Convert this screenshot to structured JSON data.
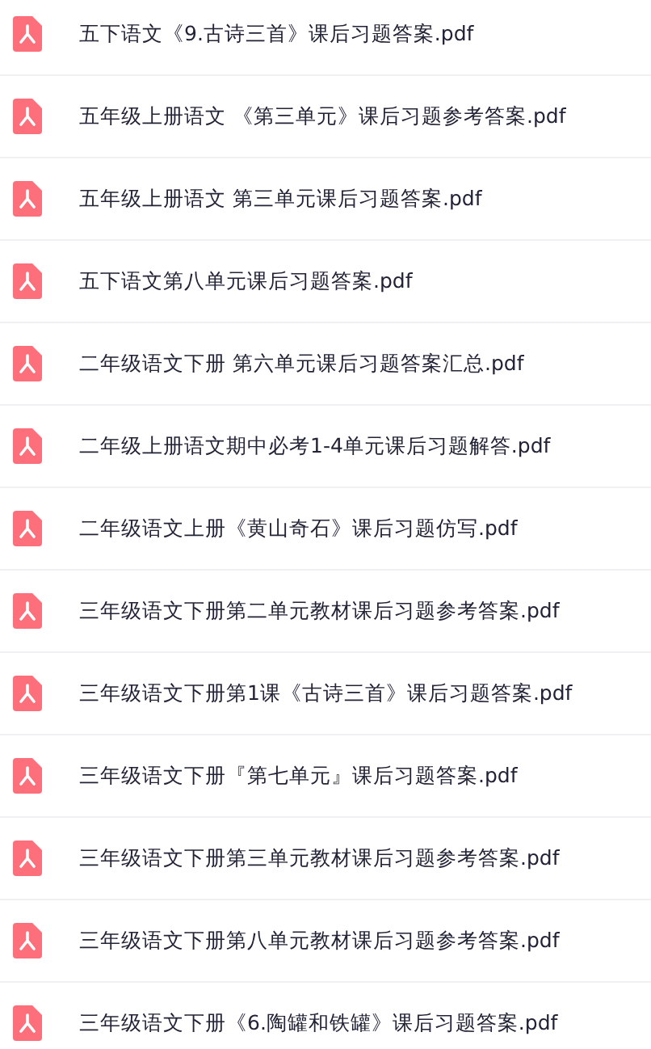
{
  "files": [
    {
      "name": "五下语文《9.古诗三首》课后习题答案.pdf"
    },
    {
      "name": "五年级上册语文 《第三单元》课后习题参考答案.pdf"
    },
    {
      "name": "五年级上册语文 第三单元课后习题答案.pdf"
    },
    {
      "name": "五下语文第八单元课后习题答案.pdf"
    },
    {
      "name": "二年级语文下册 第六单元课后习题答案汇总.pdf"
    },
    {
      "name": "二年级上册语文期中必考1-4单元课后习题解答.pdf"
    },
    {
      "name": "二年级语文上册《黄山奇石》课后习题仿写.pdf"
    },
    {
      "name": "三年级语文下册第二单元教材课后习题参考答案.pdf"
    },
    {
      "name": "三年级语文下册第1课《古诗三首》课后习题答案.pdf"
    },
    {
      "name": "三年级语文下册『第七单元』课后习题答案.pdf"
    },
    {
      "name": "三年级语文下册第三单元教材课后习题参考答案.pdf"
    },
    {
      "name": "三年级语文下册第八单元教材课后习题参考答案.pdf"
    },
    {
      "name": "三年级语文下册《6.陶罐和铁罐》课后习题答案.pdf"
    }
  ]
}
